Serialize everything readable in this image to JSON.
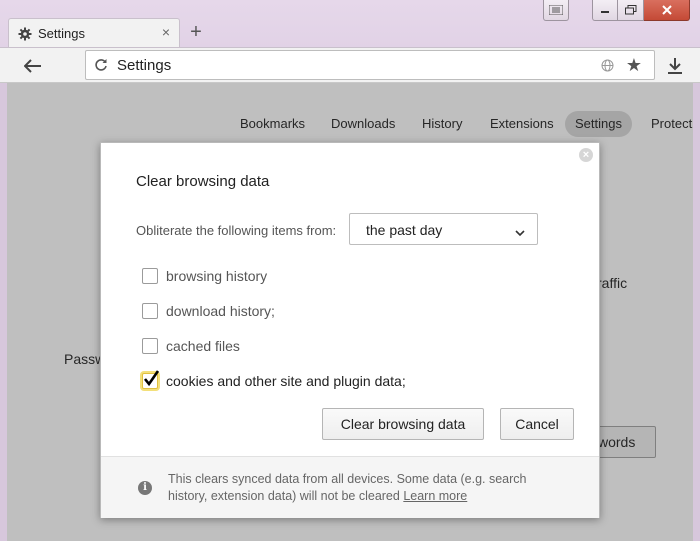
{
  "browser": {
    "tab_title": "Settings",
    "new_tab_symbol": "+",
    "tab_close_symbol": "×",
    "address": "Settings",
    "icons": {
      "tab": "gear-icon",
      "back": "arrow-left-icon",
      "reload": "reload-icon",
      "globe": "globe-icon",
      "bookmark": "star-icon",
      "download": "download-icon",
      "menu": "hamburger-icon",
      "minimize": "minimize-icon",
      "maximize": "maximize-icon",
      "close": "close-icon"
    }
  },
  "settings_nav": {
    "items": [
      "Bookmarks",
      "Downloads",
      "History",
      "Extensions",
      "Settings",
      "Protect"
    ],
    "active": "Settings"
  },
  "background": {
    "partial_text_1": "raffic",
    "partial_text_2": "Passw",
    "partial_button": "words"
  },
  "dialog": {
    "title": "Clear browsing data",
    "period_label": "Obliterate the following items from:",
    "period_value": "the past day",
    "options": [
      {
        "label": "browsing history",
        "checked": false
      },
      {
        "label": "download history;",
        "checked": false
      },
      {
        "label": "cached files",
        "checked": false
      },
      {
        "label": "cookies and other site and plugin data;",
        "checked": true
      }
    ],
    "clear_button": "Clear browsing data",
    "cancel_button": "Cancel",
    "footer_text": "This clears synced data from all devices. Some data (e.g. search history, extension data) will not be cleared",
    "footer_link": "Learn more",
    "close_symbol": "×",
    "info_symbol": "i"
  },
  "colors": {
    "titlebar": "#e1d2e6",
    "checkbox_highlight": "#f3e07a",
    "checkmark": "#000000"
  }
}
